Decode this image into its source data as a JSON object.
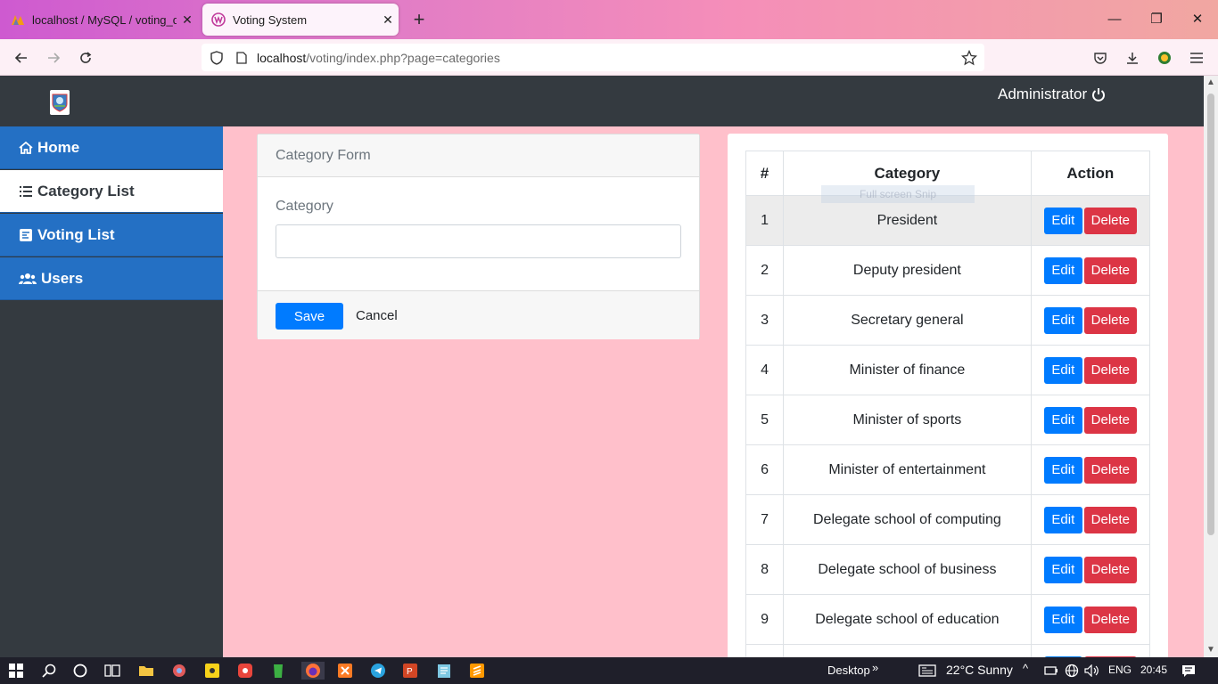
{
  "browser": {
    "tabs": [
      {
        "label": "localhost / MySQL / voting_db |",
        "active": false
      },
      {
        "label": "Voting System",
        "active": true
      }
    ],
    "url_host": "localhost",
    "url_path": "/voting/index.php?page=categories"
  },
  "app": {
    "user_label": "Administrator",
    "sidebar": [
      {
        "label": "Home",
        "icon": "home-icon",
        "active": false
      },
      {
        "label": "Category List",
        "icon": "list-icon",
        "active": true
      },
      {
        "label": "Voting List",
        "icon": "poll-icon",
        "active": false
      },
      {
        "label": "Users",
        "icon": "users-icon",
        "active": false
      }
    ],
    "form": {
      "title": "Category Form",
      "field_label": "Category",
      "field_value": "",
      "save_label": "Save",
      "cancel_label": "Cancel"
    },
    "table": {
      "headers": [
        "#",
        "Category",
        "Action"
      ],
      "edit_label": "Edit",
      "delete_label": "Delete",
      "ghost_text": "Full screen Snip",
      "rows": [
        {
          "num": "1",
          "category": "President"
        },
        {
          "num": "2",
          "category": "Deputy president"
        },
        {
          "num": "3",
          "category": "Secretary general"
        },
        {
          "num": "4",
          "category": "Minister of finance"
        },
        {
          "num": "5",
          "category": "Minister of sports"
        },
        {
          "num": "6",
          "category": "Minister of entertainment"
        },
        {
          "num": "7",
          "category": "Delegate school of computing"
        },
        {
          "num": "8",
          "category": "Delegate school of business"
        },
        {
          "num": "9",
          "category": "Delegate school of education"
        },
        {
          "num": "",
          "category": ""
        }
      ]
    }
  },
  "taskbar": {
    "desktop_label": "Desktop",
    "weather": "22°C  Sunny",
    "language": "ENG",
    "time": "20:45"
  },
  "colors": {
    "content_bg": "#ffc0cb",
    "sidebar_bg": "#343a40",
    "nav_item": "#2470c4",
    "primary": "#007bff",
    "danger": "#dc3545"
  }
}
